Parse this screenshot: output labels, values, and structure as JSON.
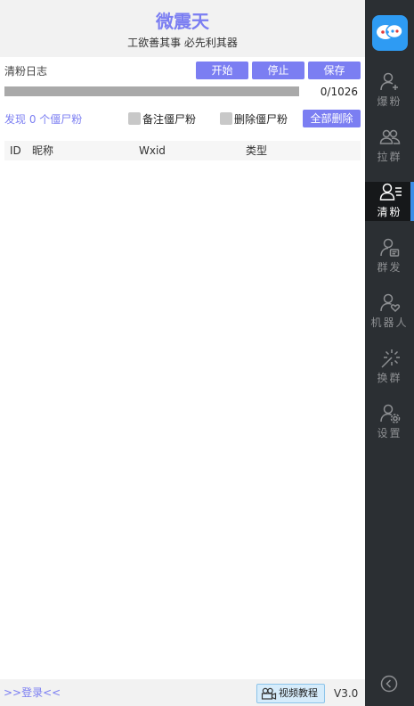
{
  "header": {
    "title": "微震天",
    "subtitle": "工欲善其事 必先利其器"
  },
  "toolbar": {
    "log_label": "清粉日志",
    "start_label": "开始",
    "stop_label": "停止",
    "save_label": "保存"
  },
  "progress": {
    "text": "0/1026",
    "fraction": 0.0
  },
  "filters": {
    "found_text": "发现 0 个僵尸粉",
    "remark_label": "备注僵尸粉",
    "delete_label": "删除僵尸粉",
    "delete_all_label": "全部删除"
  },
  "table": {
    "columns": [
      "ID",
      "昵称",
      "Wxid",
      "类型"
    ],
    "rows": []
  },
  "footer": {
    "login_label": ">>登录<<",
    "video_label": "视频教程",
    "version": "V3.0"
  },
  "sidebar": {
    "items": [
      {
        "label": "爆粉",
        "icon": "user-add-icon"
      },
      {
        "label": "拉群",
        "icon": "group-icon"
      },
      {
        "label": "清粉",
        "icon": "user-list-icon",
        "active": true
      },
      {
        "label": "群发",
        "icon": "user-message-icon"
      },
      {
        "label": "机器人",
        "icon": "user-heart-icon"
      },
      {
        "label": "换群",
        "icon": "magic-wand-icon"
      },
      {
        "label": "设置",
        "icon": "user-settings-icon"
      }
    ]
  },
  "colors": {
    "accent": "#7b7ef2",
    "sidebar_bg": "#2b2f33",
    "active_indicator": "#3b8ee8",
    "logo_bg": "#2e9bf3"
  }
}
